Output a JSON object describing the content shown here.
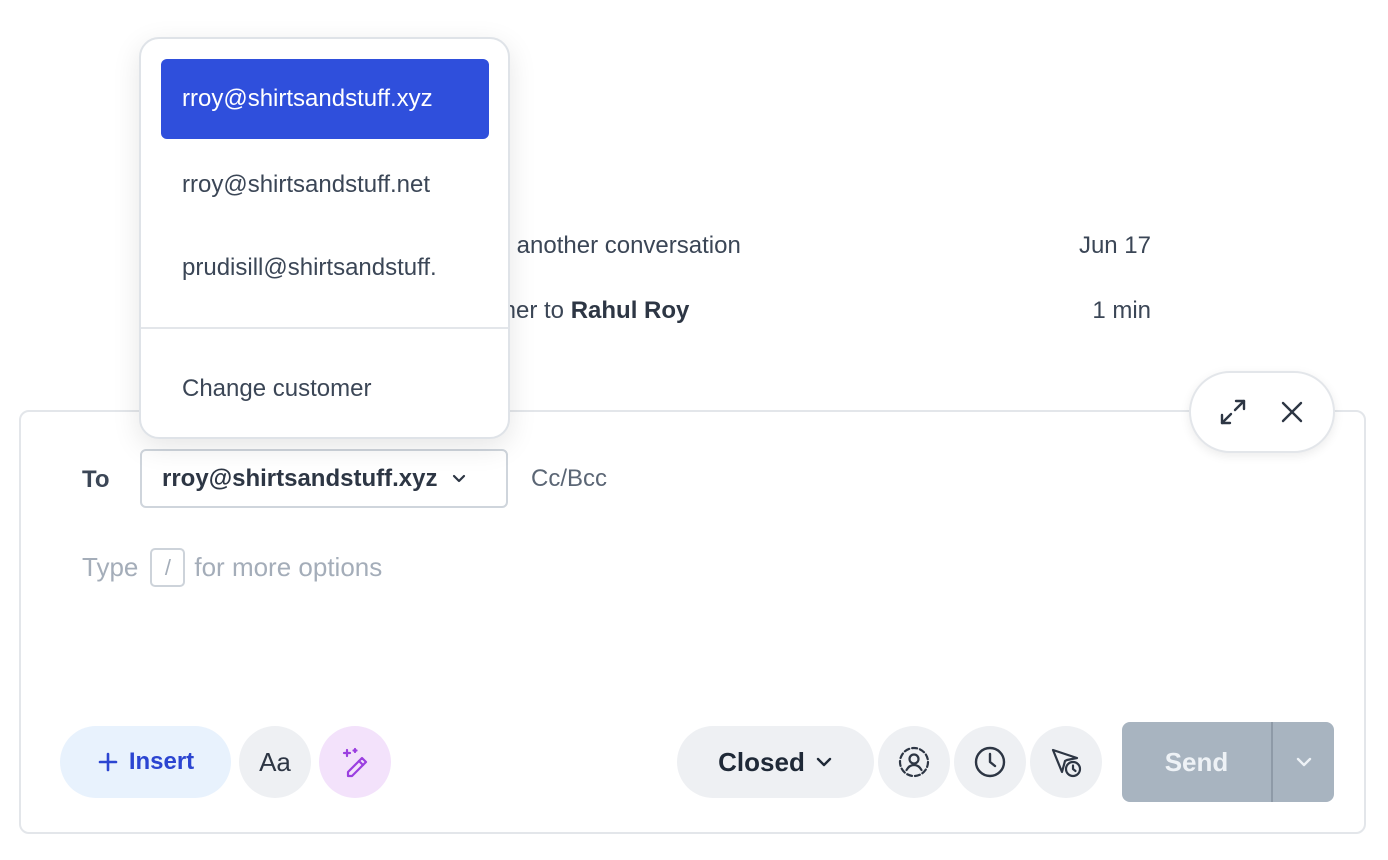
{
  "conversation": {
    "rows": [
      {
        "text": "m another conversation",
        "time": "Jun 17"
      },
      {
        "prefix": "mer to ",
        "strong": "Rahul Roy",
        "time": "1 min"
      }
    ]
  },
  "composer": {
    "to_label": "To",
    "recipient": "rroy@shirtsandstuff.xyz",
    "cc_bcc": "Cc/Bcc",
    "placeholder_before": "Type",
    "placeholder_key": "/",
    "placeholder_after": "for more options",
    "window_controls": {
      "expand_icon": "expand-icon",
      "close_icon": "close-icon"
    }
  },
  "toolbar": {
    "insert_label": "Insert",
    "text_format_label": "Aa",
    "status_label": "Closed",
    "send_label": "Send",
    "icons": [
      "plus-icon",
      "magic-pen-icon",
      "chevron-down-icon",
      "assign-user-icon",
      "clock-icon",
      "schedule-send-icon"
    ]
  },
  "recipient_dropdown": {
    "options": [
      "rroy@shirtsandstuff.xyz",
      "rroy@shirtsandstuff.net",
      "prudisill@shirtsandstuff."
    ],
    "selected_index": 0,
    "change_customer_label": "Change customer"
  },
  "colors": {
    "accent": "#2f4fdc",
    "insert_bg": "#e8f2fd",
    "ai_bg": "#f3e2fb",
    "send_disabled": "#a8b4c0"
  }
}
